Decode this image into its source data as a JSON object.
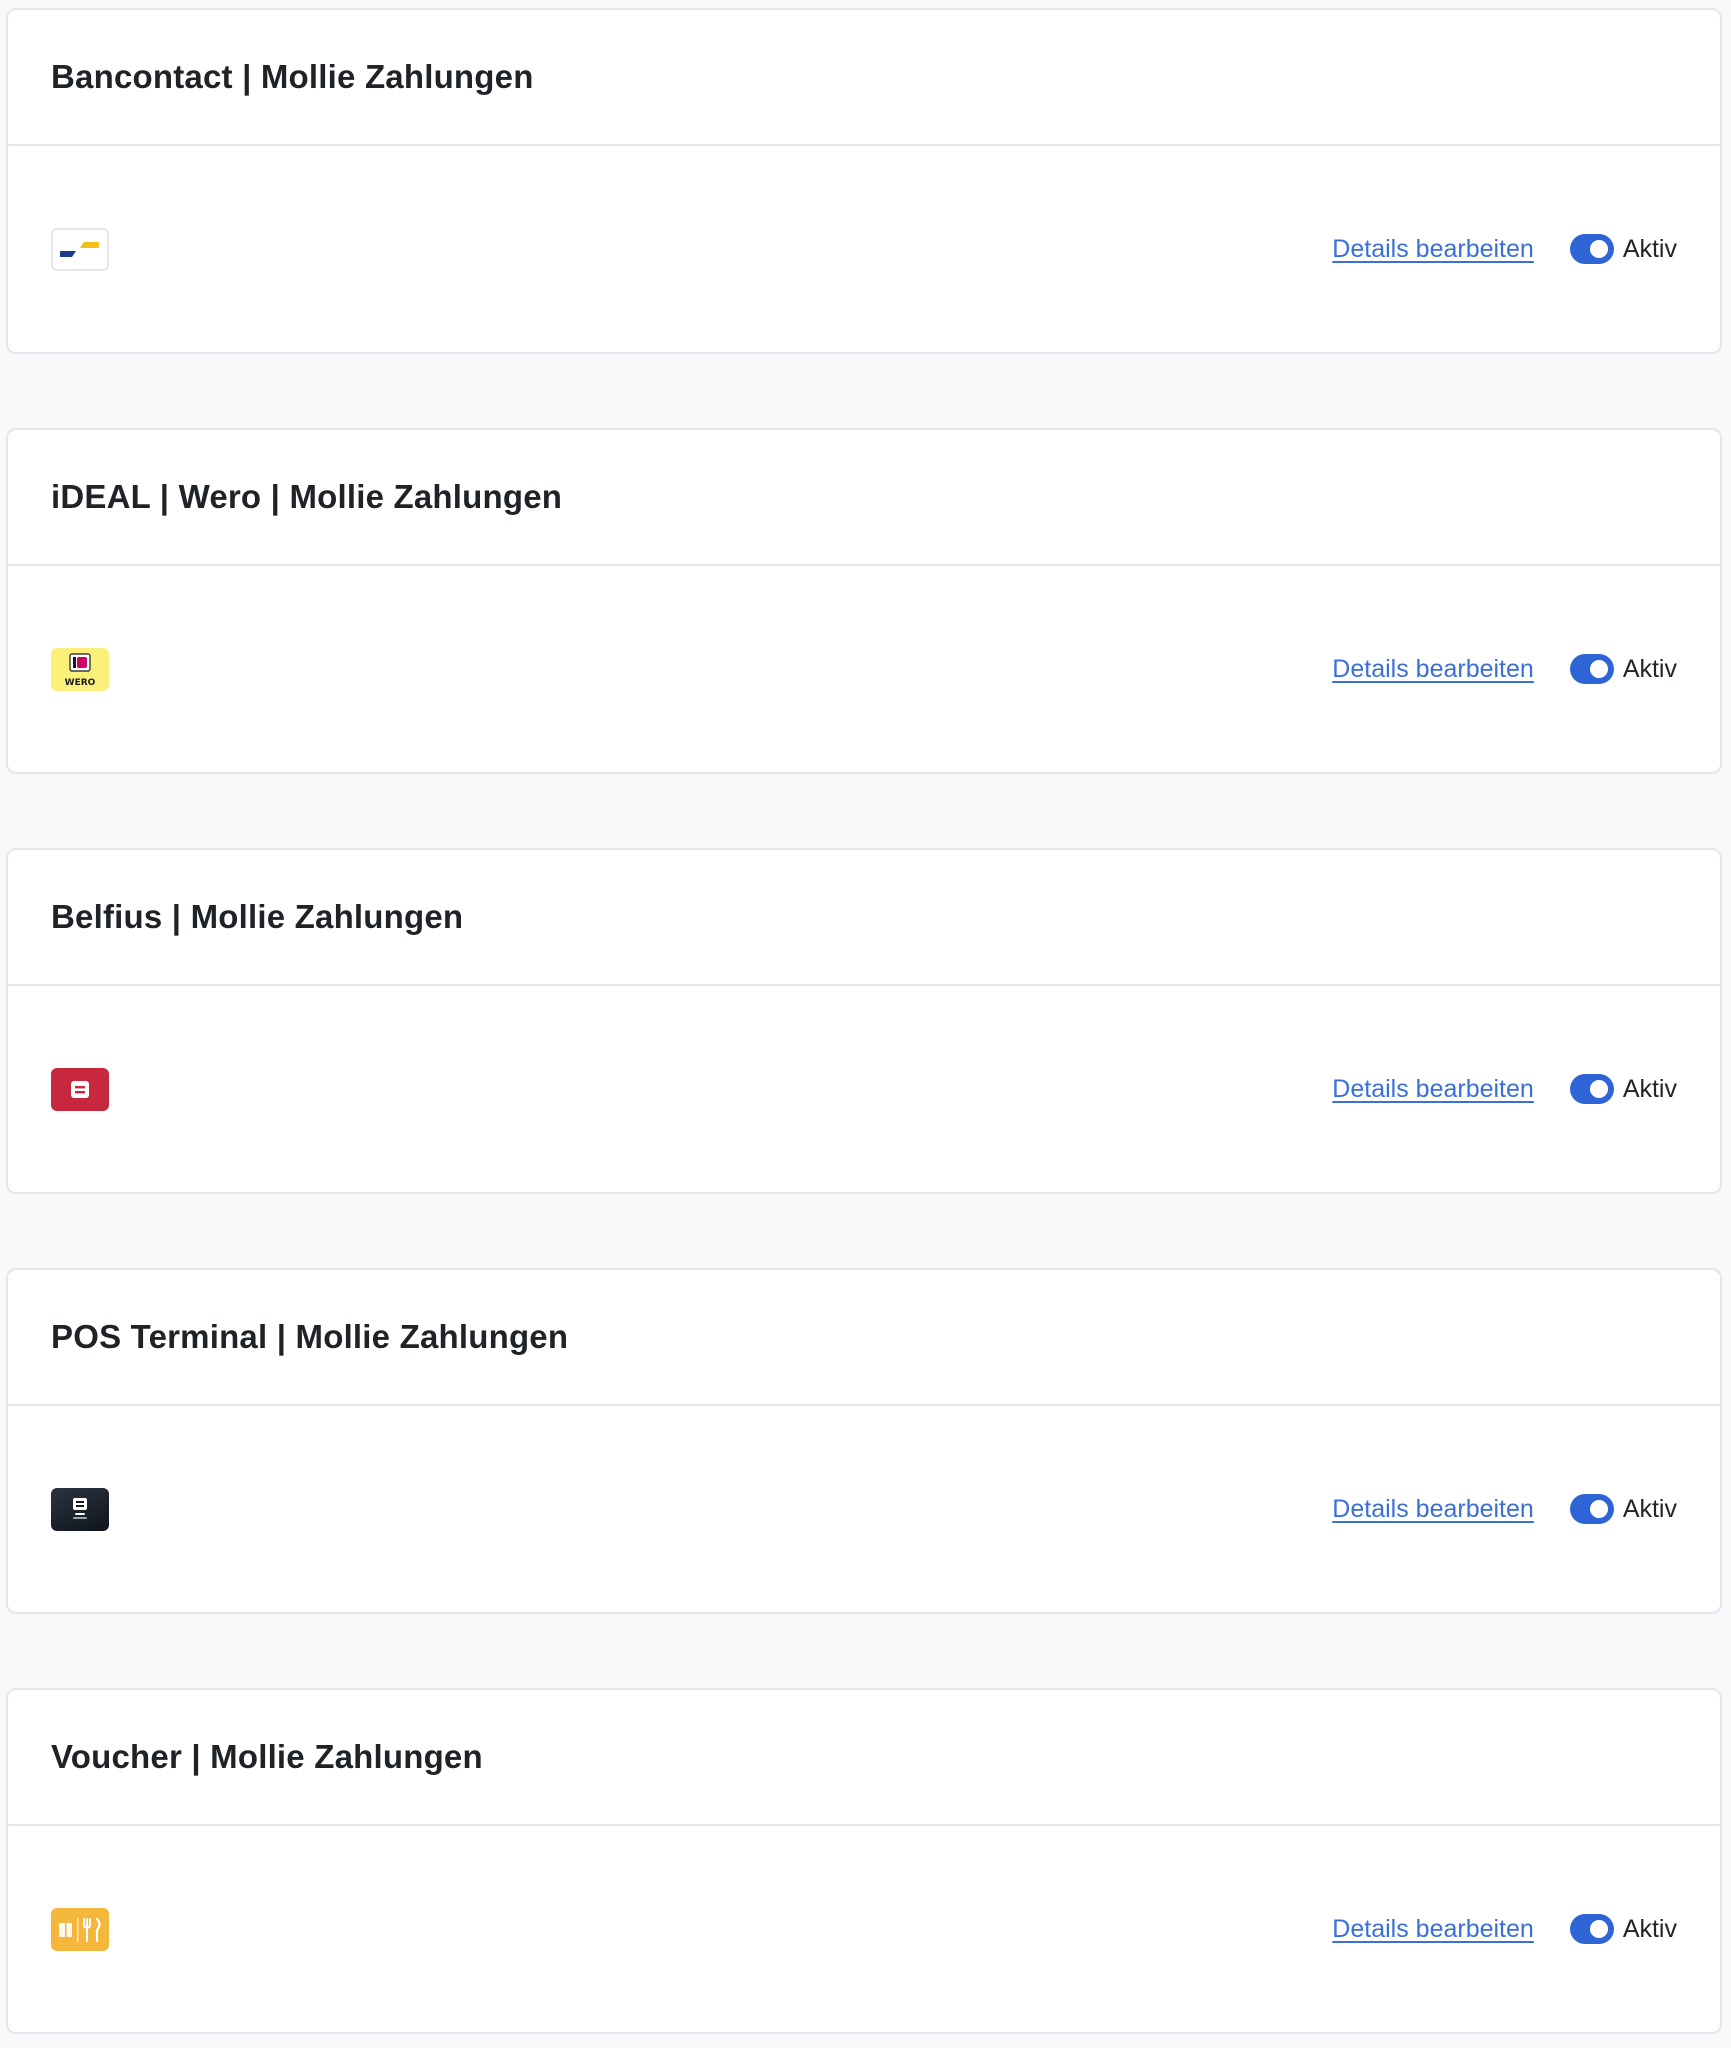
{
  "colors": {
    "page_bg": "#f8f9fb",
    "card_bg": "#ffffff",
    "border": "#e3e6ea",
    "link": "#3a6fd8",
    "toggle_on": "#2f64d6"
  },
  "payment_methods": [
    {
      "title": "Bancontact | Mollie Zahlungen",
      "logo_icon": "bancontact-logo-icon",
      "details_label": "Details bearbeiten",
      "status_label": "Aktiv",
      "active": true
    },
    {
      "title": "iDEAL | Wero | Mollie Zahlungen",
      "logo_icon": "ideal-wero-logo-icon",
      "logo_text": "WERO",
      "details_label": "Details bearbeiten",
      "status_label": "Aktiv",
      "active": true
    },
    {
      "title": "Belfius | Mollie Zahlungen",
      "logo_icon": "belfius-logo-icon",
      "details_label": "Details bearbeiten",
      "status_label": "Aktiv",
      "active": true
    },
    {
      "title": "POS Terminal | Mollie Zahlungen",
      "logo_icon": "pos-terminal-logo-icon",
      "details_label": "Details bearbeiten",
      "status_label": "Aktiv",
      "active": true
    },
    {
      "title": "Voucher | Mollie Zahlungen",
      "logo_icon": "voucher-logo-icon",
      "details_label": "Details bearbeiten",
      "status_label": "Aktiv",
      "active": true
    }
  ]
}
